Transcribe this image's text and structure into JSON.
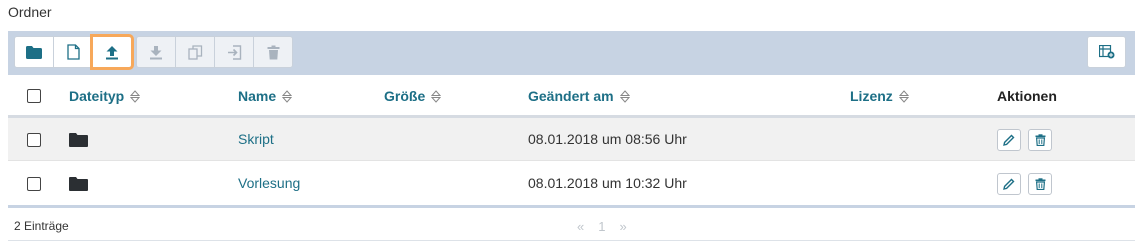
{
  "section": {
    "title": "Ordner"
  },
  "toolbar": {
    "group1": [
      {
        "name": "new-folder-button",
        "icon": "folder-icon",
        "disabled": false
      },
      {
        "name": "new-file-button",
        "icon": "file-icon",
        "disabled": false
      },
      {
        "name": "upload-button",
        "icon": "upload-icon",
        "disabled": false,
        "highlighted": true
      }
    ],
    "group2": [
      {
        "name": "download-button",
        "icon": "download-icon",
        "disabled": true
      },
      {
        "name": "copy-button",
        "icon": "copy-icon",
        "disabled": true
      },
      {
        "name": "move-button",
        "icon": "move-icon",
        "disabled": true
      },
      {
        "name": "delete-selected-button",
        "icon": "trash-icon",
        "disabled": true
      }
    ],
    "right": {
      "name": "column-settings-button",
      "icon": "table-settings-icon"
    }
  },
  "table": {
    "columns": {
      "filetype": "Dateityp",
      "name": "Name",
      "size": "Größe",
      "modified": "Geändert am",
      "license": "Lizenz",
      "actions": "Aktionen"
    },
    "rows": [
      {
        "name": "Skript",
        "size": "",
        "modified": "08.01.2018 um 08:56 Uhr",
        "license": ""
      },
      {
        "name": "Vorlesung",
        "size": "",
        "modified": "08.01.2018 um 10:32 Uhr",
        "license": ""
      }
    ]
  },
  "footer": {
    "count": "2 Einträge",
    "pager": {
      "prev": "«",
      "page": "1",
      "next": "»"
    }
  },
  "colors": {
    "accent": "#1d6f86",
    "toolbar_bg": "#c7d3e3",
    "highlight": "#f7a85a"
  }
}
